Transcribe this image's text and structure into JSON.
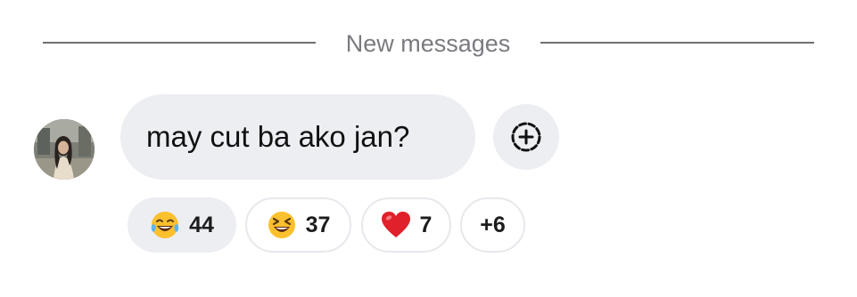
{
  "divider": {
    "label": "New messages"
  },
  "message": {
    "text": "may cut ba ako jan?",
    "avatar_icon": "user-avatar-photo"
  },
  "add_reaction": {
    "icon": "add-reaction-icon"
  },
  "reactions": [
    {
      "emoji": "face-with-tears-of-joy",
      "count": "44",
      "selected": true
    },
    {
      "emoji": "grinning-squinting-face",
      "count": "37",
      "selected": false
    },
    {
      "emoji": "red-heart",
      "count": "7",
      "selected": false
    }
  ],
  "more_reactions": {
    "label": "+6"
  },
  "colors": {
    "bubble": "#eceef2",
    "divider": "#6f6f75",
    "divider_text": "#7a7a80",
    "emoji_yellow": "#fbc02d",
    "heart_red": "#e0202a"
  }
}
